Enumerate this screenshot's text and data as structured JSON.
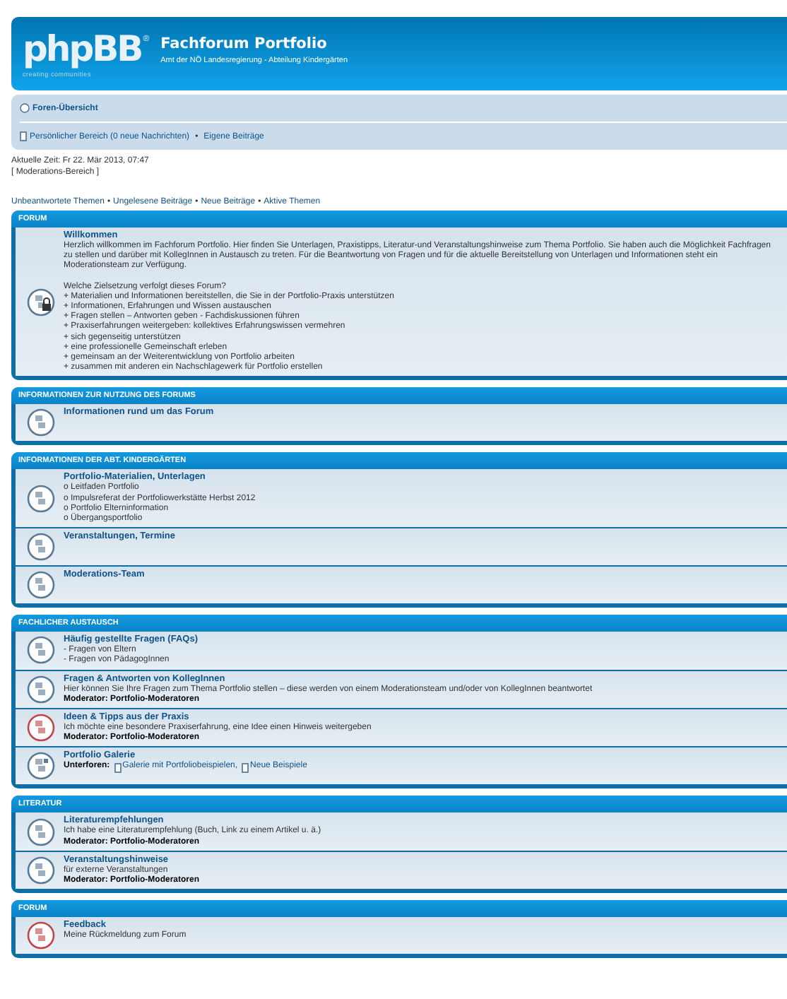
{
  "header": {
    "logo": "phpBB",
    "logo_mark": "®",
    "tagline": "creating communities",
    "title": "Fachforum Portfolio",
    "subtitle": "Amt der NÖ Landesregierung - Abteilung Kindergärten"
  },
  "navbar": {
    "home": "Foren-Übersicht",
    "personal": "Persönlicher Bereich (0 neue Nachrichten)",
    "separator": "•",
    "own_posts": "Eigene Beiträge"
  },
  "time": "Aktuelle Zeit: Fr 22. Mär 2013, 07:47",
  "mod_link": "[ Moderations-Bereich ]",
  "quick_links": {
    "separator": "•",
    "links": [
      "Unbeantwortete Themen",
      "Ungelesene Beiträge",
      "Neue Beiträge",
      "Aktive Themen"
    ]
  },
  "categories": [
    {
      "title": "FORUM",
      "forums": [
        {
          "kind": "locked",
          "title": "Willkommen",
          "description": "Herzlich willkommen im Fachforum Portfolio. Hier finden Sie Unterlagen, Praxistipps, Literatur-und Veranstaltungshinweise zum Thema Portfolio. Sie haben auch die Möglichkeit Fachfragen zu stellen und darüber mit KollegInnen in Austausch zu treten. Für die Beantwortung von Fragen und für die aktuelle Bereitstellung von Unterlagen und Informationen steht ein Moderationsteam zur Verfügung.",
          "lines": [
            "Welche Zielsetzung verfolgt dieses Forum?",
            "+ Materialien und Informationen bereitstellen, die Sie in der Portfolio-Praxis unterstützen",
            "+ Informationen, Erfahrungen und Wissen austauschen",
            "+ Fragen stellen – Antworten geben - Fachdiskussionen führen",
            "+ Praxiserfahrungen weitergeben: kollektives Erfahrungswissen vermehren",
            "+ sich gegenseitig unterstützen",
            "+ eine professionelle Gemeinschaft erleben",
            "+ gemeinsam an der Weiterentwicklung von Portfolio arbeiten",
            "+ zusammen mit anderen ein Nachschlagewerk für Portfolio erstellen"
          ]
        }
      ]
    },
    {
      "title": "INFORMATIONEN ZUR NUTZUNG DES FORUMS",
      "forums": [
        {
          "kind": "read",
          "title": "Informationen rund um das Forum"
        }
      ]
    },
    {
      "title": "INFORMATIONEN DER ABT. KINDERGÄRTEN",
      "forums": [
        {
          "kind": "read",
          "title": "Portfolio-Materialien, Unterlagen",
          "lines": [
            "o Leitfaden Portfolio",
            "o Impulsreferat der Portfoliowerkstätte Herbst 2012",
            "o Portfolio Elterninformation",
            "o Übergangsportfolio"
          ]
        },
        {
          "kind": "read",
          "title": "Veranstaltungen, Termine"
        },
        {
          "kind": "read",
          "title": "Moderations-Team"
        }
      ]
    },
    {
      "title": "FACHLICHER AUSTAUSCH",
      "forums": [
        {
          "kind": "read",
          "title": "Häufig gestellte Fragen (FAQs)",
          "lines": [
            "- Fragen von Eltern",
            "- Fragen von PädagogInnen"
          ]
        },
        {
          "kind": "read",
          "title": "Fragen & Antworten von KollegInnen",
          "lines": [
            "Hier können Sie Ihre Fragen zum Thema Portfolio stellen – diese werden von einem Moderationsteam und/oder von KollegInnen beantwortet"
          ],
          "moderator": {
            "label": "Moderator:",
            "value": "Portfolio-Moderatoren"
          }
        },
        {
          "kind": "unread",
          "title": "Ideen & Tipps aus der Praxis",
          "lines": [
            "Ich möchte eine besondere Praxiserfahrung, eine Idee einen Hinweis weitergeben"
          ],
          "moderator": {
            "label": "Moderator:",
            "value": "Portfolio-Moderatoren"
          }
        },
        {
          "kind": "subforum",
          "title": "Portfolio Galerie",
          "subforums": {
            "label": "Unterforen:",
            "items": [
              "Galerie mit Portfoliobeispielen,",
              "Neue Beispiele"
            ]
          }
        }
      ]
    },
    {
      "title": "LITERATUR",
      "forums": [
        {
          "kind": "read",
          "title": "Literaturempfehlungen",
          "lines": [
            "Ich habe eine Literaturempfehlung (Buch, Link zu einem Artikel u. ä.)"
          ],
          "moderator": {
            "label": "Moderator:",
            "value": "Portfolio-Moderatoren"
          }
        },
        {
          "kind": "read",
          "title": "Veranstaltungshinweise",
          "lines": [
            "für externe Veranstaltungen"
          ],
          "moderator": {
            "label": "Moderator:",
            "value": "Portfolio-Moderatoren"
          }
        }
      ]
    },
    {
      "title": "FORUM",
      "forums": [
        {
          "kind": "unread",
          "title": "Feedback",
          "lines": [
            "Meine Rückmeldung zum Forum"
          ]
        }
      ]
    }
  ]
}
